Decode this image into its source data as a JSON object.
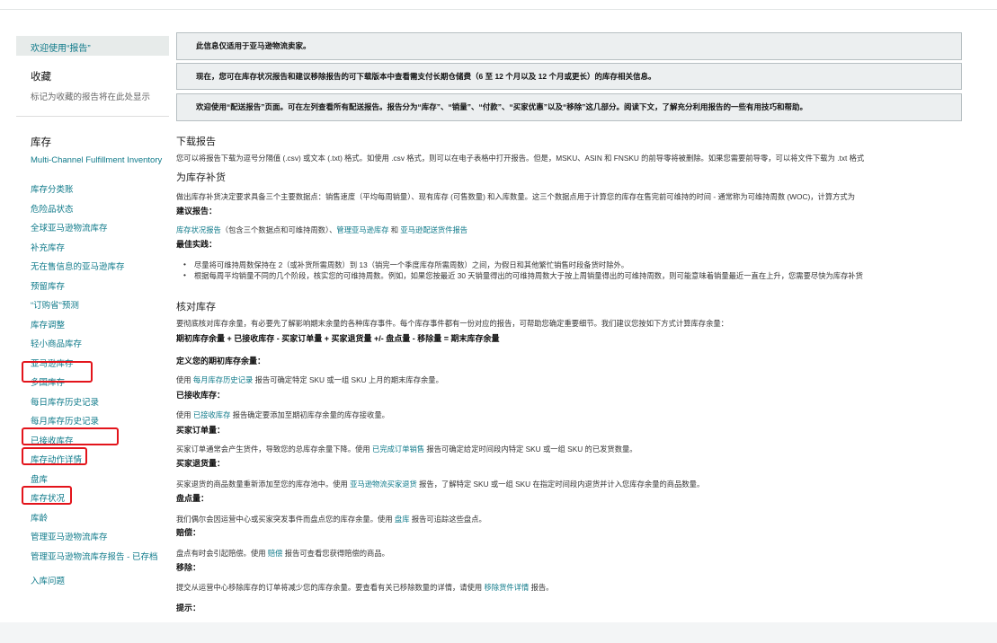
{
  "sidebar": {
    "welcome": "欢迎使用“报告”",
    "favorites_title": "收藏",
    "favorites_sub": "标记为收藏的报告将在此处显示",
    "section_title": "库存",
    "items": [
      "Multi-Channel Fulfillment Inventory",
      "库存分类账",
      "危险品状态",
      "全球亚马逊物流库存",
      "补充库存",
      "无在售信息的亚马逊库存",
      "预留库存",
      "“订购省”预测",
      "库存调整",
      "轻小商品库存",
      "亚马逊库存",
      "多国库存",
      "每日库存历史记录",
      "每月库存历史记录",
      "已接收库存",
      "库存动作详情",
      "盘库",
      "库存状况",
      "库龄",
      "管理亚马逊物流库存",
      "管理亚马逊物流库存报告 - 已存档",
      "入库问题"
    ]
  },
  "notices": [
    "此信息仅适用于亚马逊物流卖家。",
    "现在，您可在库存状况报告和建议移除报告的可下载版本中查看需支付长期仓储费（6 至 12 个月以及 12 个月或更长）的库存相关信息。",
    "欢迎使用“配送报告”页面。可在左列查看所有配送报告。报告分为“库存”、“销量”、“付款”、“买家优惠”以及“移除”这几部分。阅读下文，了解充分利用报告的一些有用技巧和帮助。"
  ],
  "content": {
    "download_title": "下载报告",
    "download_p": "您可以将报告下载为逗号分隔值 (.csv) 或文本 (.txt) 格式。如使用 .csv 格式，则可以在电子表格中打开报告。但是，MSKU、ASIN 和 FNSKU 的前导零将被删除。如果您需要前导零，可以将文件下载为 .txt 格式",
    "replenish_title": "为库存补货",
    "replenish_p": "做出库存补货决定要求具备三个主要数据点：销售速度（平均每周销量）、现有库存 (可售数量) 和入库数量。这三个数据点用于计算您的库存在售完前可维持的时间 - 通常称为可维持周数 (WOC)，计算方式为",
    "suggest_title": "建议报告：",
    "suggest_link1": "库存状况报告",
    "suggest_mid1": "（包含三个数据点和可维持周数）、",
    "suggest_link2": "管理亚马逊库存",
    "suggest_mid2": " 和 ",
    "suggest_link3": "亚马逊配送货件报告",
    "best_title": "最佳实践：",
    "best_1": "尽量将可维持周数保持在 2（或补货所需周数）到 13（销完一个季度库存所需周数）之间，为假日和其他繁忙销售时段备货时除外。",
    "best_2": "根据每周平均销量不同的几个阶段，核实您的可维持周数。例如，如果您按最近 30 天销量得出的可维持周数大于按上周销量得出的可维持周数，则可能意味着销量最近一直在上升，您需要尽快为库存补货",
    "reconcile_title": "核对库存",
    "reconcile_p": "要彻底核对库存余量，有必要先了解影响期末余量的各种库存事件。每个库存事件都有一份对应的报告，可帮助您确定重要细节。我们建议您按如下方式计算库存余量：",
    "formula": "期初库存余量 + 已接收库存 - 买家订单量 + 买家退货量 +/- 盘点量 - 移除量 = 期末库存余量",
    "define_title": "定义您的期初库存余量：",
    "define_pre": "使用 ",
    "define_link": "每月库存历史记录",
    "define_post": " 报告可确定特定 SKU 或一组 SKU 上月的期末库存余量。",
    "received_title": "已接收库存：",
    "received_pre": "使用 ",
    "received_link": "已接收库存",
    "received_post": " 报告确定要添加至期初库存余量的库存接收量。",
    "orders_title": "买家订单量：",
    "orders_pre": "买家订单通常会产生货件，导致您的总库存余量下降。使用 ",
    "orders_link": "已完成订单销售",
    "orders_post": " 报告可确定给定时间段内特定 SKU 或一组 SKU 的已发货数量。",
    "returns_title": "买家退货量：",
    "returns_pre": "买家退货的商品数量重新添加至您的库存池中。使用 ",
    "returns_link": "亚马逊物流买家退货",
    "returns_post": " 报告，了解特定 SKU 或一组 SKU 在指定时间段内退货并计入您库存余量的商品数量。",
    "count_title": "盘点量：",
    "count_pre": "我们偶尔会因运营中心或买家突发事件而盘点您的库存余量。使用 ",
    "count_link": "盘库",
    "count_post": " 报告可追踪这些盘点。",
    "reimb_title": "赔偿：",
    "reimb_pre": "盘点有时会引起赔偿。使用 ",
    "reimb_link": "赔偿",
    "reimb_post": " 报告可查看您获得赔偿的商品。",
    "remove_title": "移除：",
    "remove_pre": "提交从运营中心移除库存的订单将减少您的库存余量。要查看有关已移除数量的详情，请使用 ",
    "remove_link": "移除货件详情",
    "remove_post": " 报告。",
    "tips_title": "提示："
  },
  "colors": {
    "link": "#0f7a8a",
    "highlight": "#e3141b",
    "notice_bg": "#eceff0"
  }
}
